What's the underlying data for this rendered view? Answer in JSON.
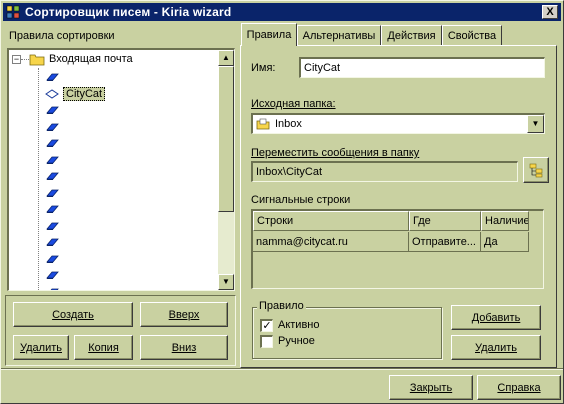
{
  "window": {
    "title": "Сортировщик писем - Kiria wizard",
    "close_label": "X"
  },
  "left": {
    "header": "Правила сортировки",
    "tree": {
      "root_label": "Входящая почта",
      "selected_rule": "CityCat",
      "empty_rule_count": 13
    },
    "buttons": {
      "create": "Создать",
      "up": "Вверх",
      "delete": "Удалить",
      "copy": "Копия",
      "down": "Вниз"
    }
  },
  "tabs": [
    {
      "label": "Правила",
      "active": true
    },
    {
      "label": "Альтернативы",
      "active": false
    },
    {
      "label": "Действия",
      "active": false
    },
    {
      "label": "Свойства",
      "active": false
    }
  ],
  "rule": {
    "name_label": "Имя:",
    "name_value": "CityCat",
    "source_folder_label": "Исходная папка:",
    "source_folder_value": "Inbox",
    "move_label": "Переместить сообщения в папку",
    "move_value": "Inbox\\CityCat",
    "signal_strings_label": "Сигнальные строки",
    "table": {
      "columns": [
        "Строки",
        "Где",
        "Наличие"
      ],
      "rows": [
        {
          "string": "namma@citycat.ru",
          "where": "Отправите...",
          "presence": "Да"
        }
      ]
    },
    "group": {
      "title": "Правило",
      "active_label": "Активно",
      "active_checked": true,
      "manual_label": "Ручное",
      "manual_checked": false
    },
    "add_button": "Добавить",
    "delete_button": "Удалить"
  },
  "footer": {
    "close": "Закрыть",
    "help": "Справка"
  }
}
